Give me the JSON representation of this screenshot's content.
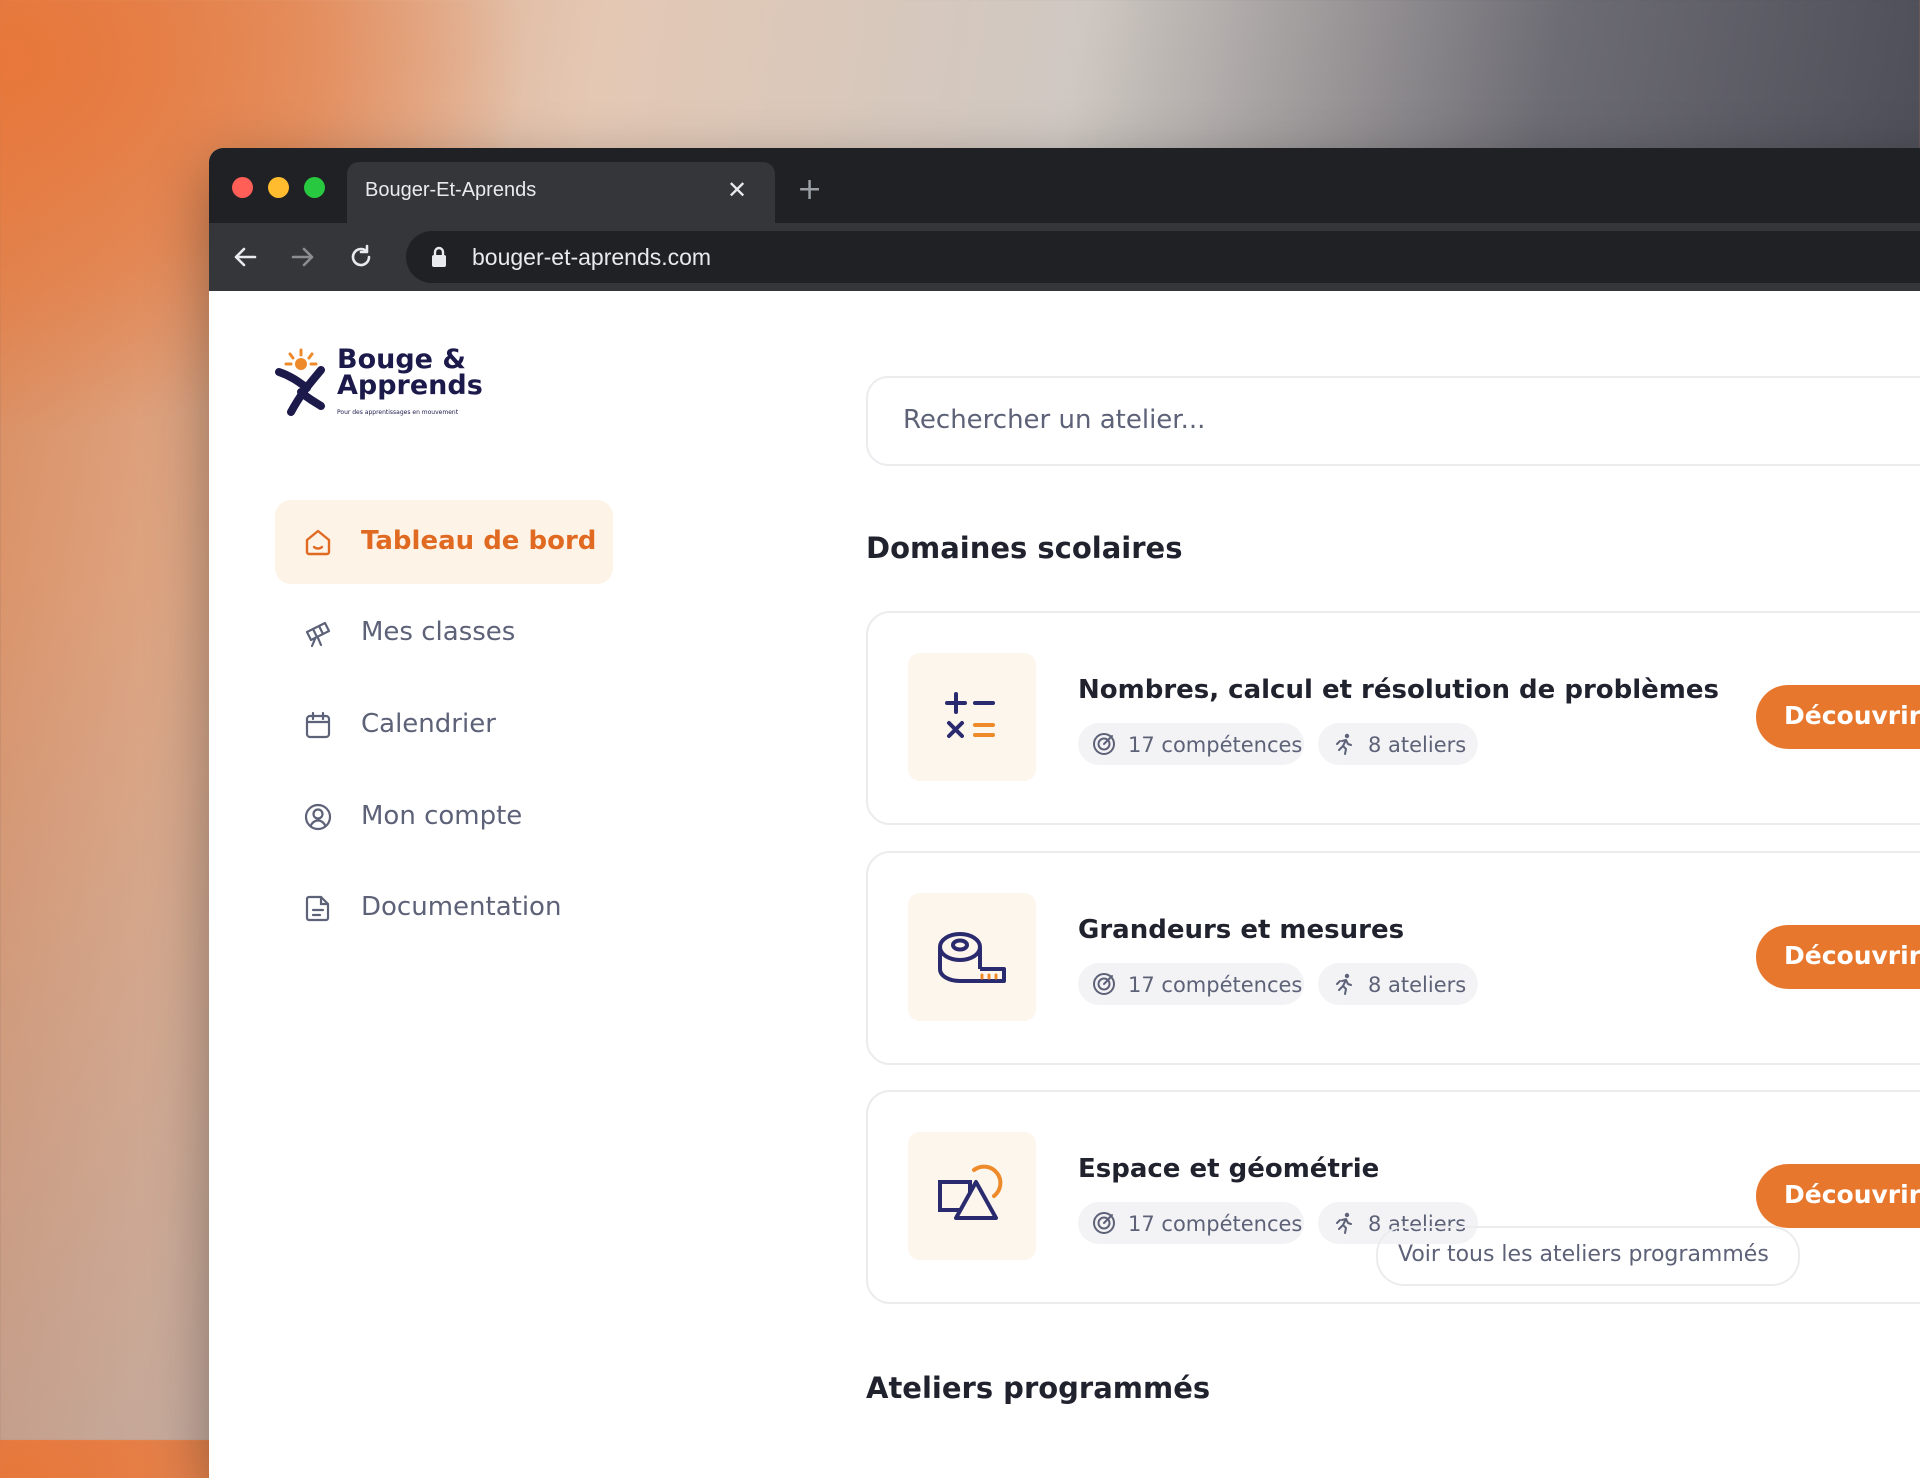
{
  "browser": {
    "tab_title": "Bouger-Et-Aprends",
    "url": "bouger-et-aprends.com",
    "colors": {
      "close": "#ff5f57",
      "minimize": "#febc2e",
      "maximize": "#28c840"
    }
  },
  "logo": {
    "line1": "Bouge &",
    "line2": "Apprends",
    "tagline": "Pour des apprentissages en mouvement"
  },
  "sidebar": {
    "items": [
      {
        "label": "Tableau de bord",
        "icon": "home-icon",
        "active": true
      },
      {
        "label": "Mes classes",
        "icon": "telescope-icon",
        "active": false
      },
      {
        "label": "Calendrier",
        "icon": "calendar-icon",
        "active": false
      },
      {
        "label": "Mon compte",
        "icon": "user-circle-icon",
        "active": false
      },
      {
        "label": "Documentation",
        "icon": "document-icon",
        "active": false
      }
    ]
  },
  "search": {
    "placeholder": "Rechercher un atelier..."
  },
  "domains": {
    "title": "Domaines scolaires",
    "cards": [
      {
        "title": "Nombres, calcul et résolution de problèmes",
        "icon": "math-operators-icon",
        "skills": "17 compétences",
        "workshops": "8 ateliers",
        "button": "Découvrir"
      },
      {
        "title": "Grandeurs et mesures",
        "icon": "tape-measure-icon",
        "skills": "17 compétences",
        "workshops": "8 ateliers",
        "button": "Découvrir"
      },
      {
        "title": "Espace et géométrie",
        "icon": "shapes-icon",
        "skills": "17 compétences",
        "workshops": "8 ateliers",
        "button": "Découvrir"
      }
    ]
  },
  "scheduled": {
    "title": "Ateliers programmés",
    "see_all": "Voir tous les ateliers programmés"
  },
  "colors": {
    "accent": "#e8772e",
    "navy": "#1c1a4a",
    "active_bg": "#fdf3e6"
  }
}
